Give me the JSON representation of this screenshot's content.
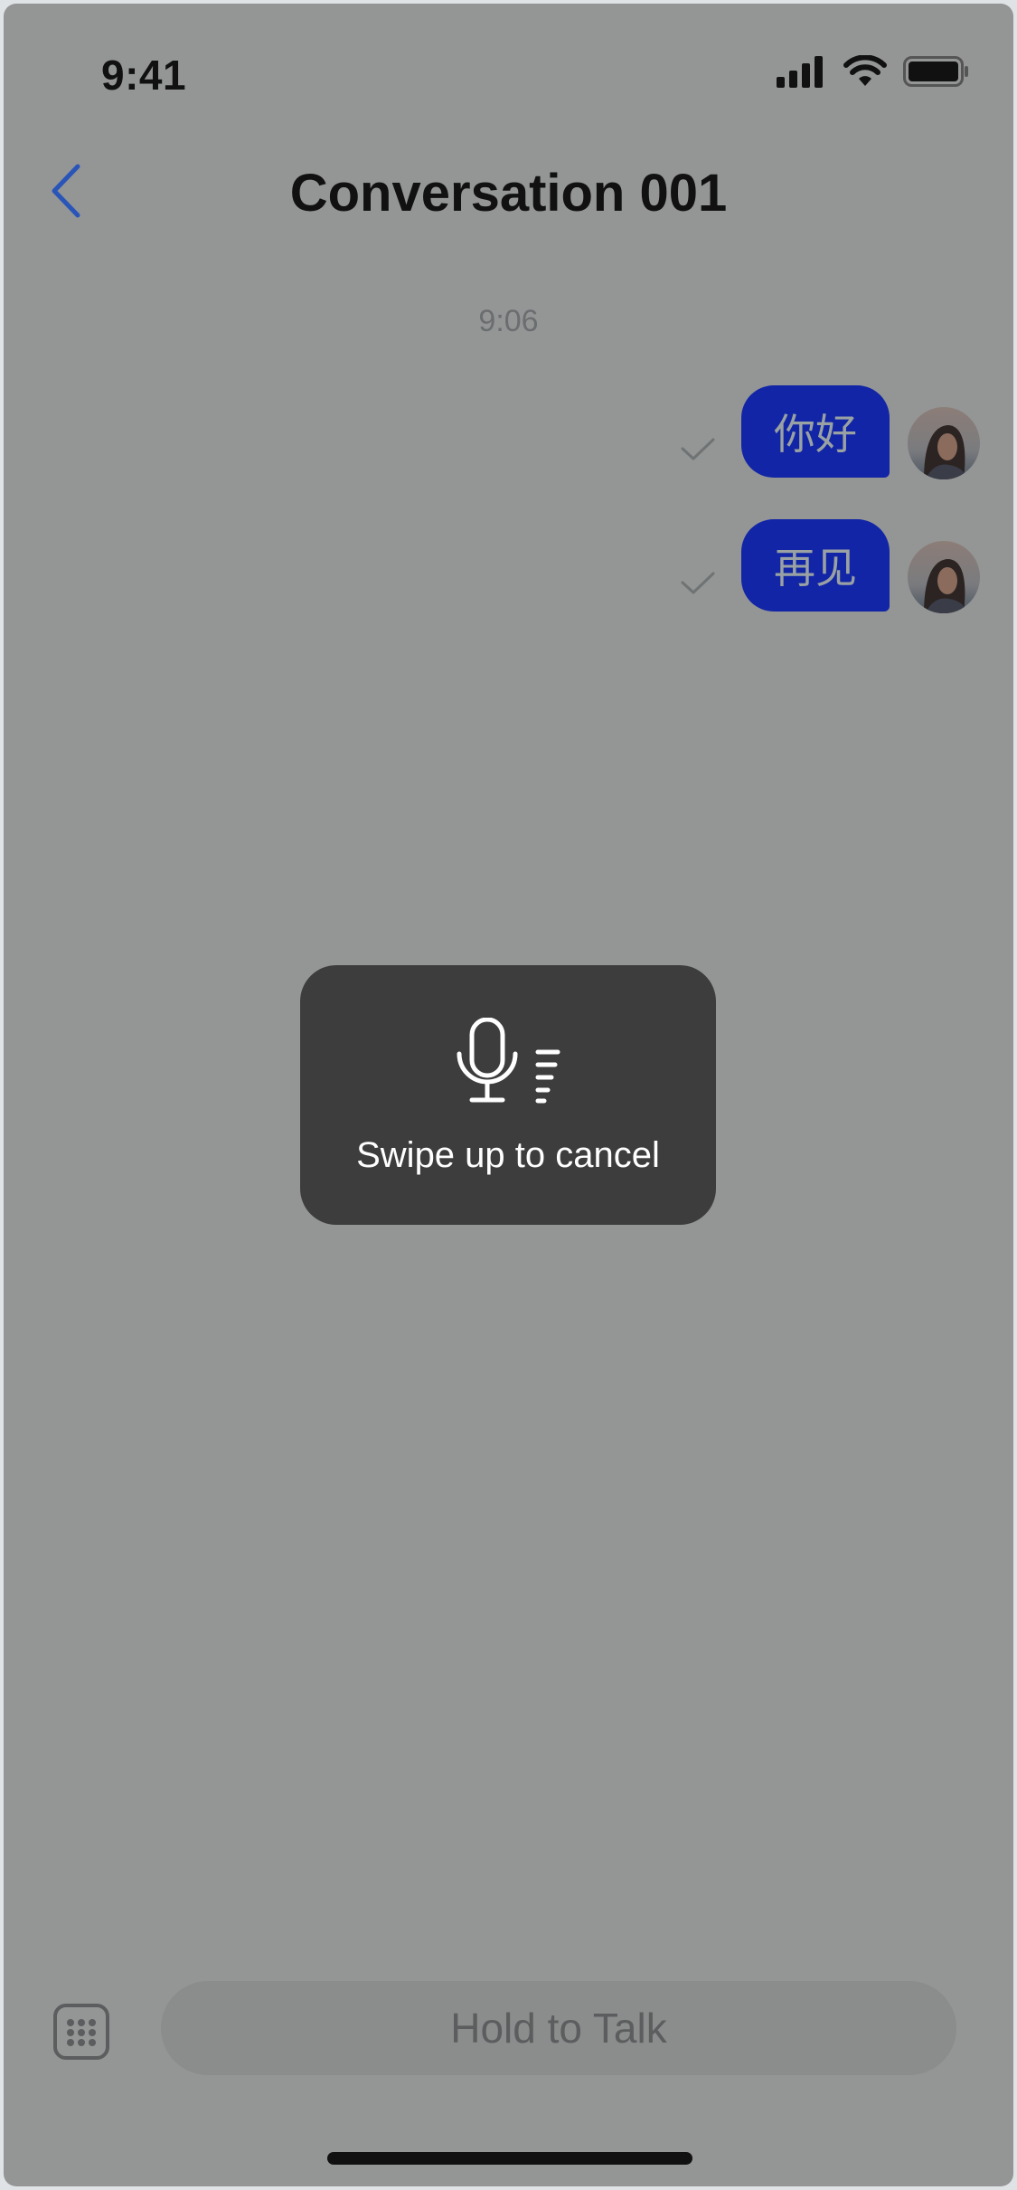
{
  "status_bar": {
    "time": "9:41",
    "icons": [
      "signal-icon",
      "wifi-icon",
      "battery-icon"
    ]
  },
  "nav": {
    "back_icon": "chevron-left-icon",
    "title": "Conversation 001"
  },
  "messages": {
    "timestamp": "9:06",
    "items": [
      {
        "text": "你好",
        "status_icon": "checkmark-icon",
        "sender": "me"
      },
      {
        "text": "再见",
        "status_icon": "checkmark-icon",
        "sender": "me"
      }
    ]
  },
  "recording": {
    "icon": "microphone-icon",
    "hint": "Swipe up to cancel"
  },
  "input_bar": {
    "keyboard_icon": "keyboard-icon",
    "hold_label": "Hold to Talk"
  },
  "colors": {
    "background_dim": "#949595",
    "bubble": "#1125a6",
    "accent_back": "#2a55b8",
    "panel": "#3d3d3d"
  }
}
